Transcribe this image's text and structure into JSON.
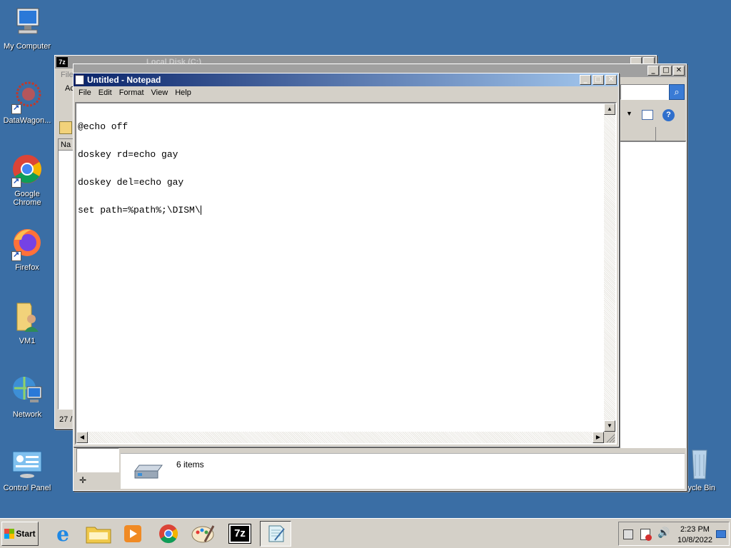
{
  "desktop": {
    "icons": [
      {
        "label": "My Computer",
        "icon": "my-computer-icon"
      },
      {
        "label": "DataWagon...",
        "icon": "datawagon-icon"
      },
      {
        "label": "Google Chrome",
        "icon": "chrome-icon"
      },
      {
        "label": "Firefox",
        "icon": "firefox-icon"
      },
      {
        "label": "VM1",
        "icon": "user-folder-icon"
      },
      {
        "label": "Network",
        "icon": "network-icon"
      },
      {
        "label": "Control Panel",
        "icon": "control-panel-icon"
      },
      {
        "label": "cycle Bin",
        "icon": "recycle-bin-icon"
      }
    ]
  },
  "explorer_back": {
    "title_fragment": "Local Disk (C:)",
    "menu_file": "File",
    "address_fragment": "Ac",
    "column_name": "Na",
    "status_count": "27 /"
  },
  "explorer_front": {
    "details_text": "6 items"
  },
  "notepad": {
    "title": "Untitled - Notepad",
    "menu": [
      "File",
      "Edit",
      "Format",
      "View",
      "Help"
    ],
    "lines": [
      "@echo off",
      "doskey rd=echo gay",
      "doskey del=echo gay",
      "set path=%path%;\\DISM\\"
    ],
    "buttons": {
      "minimize": "_",
      "maximize": "□",
      "close": "✕"
    }
  },
  "taskbar": {
    "start_label": "Start",
    "apps": [
      {
        "name": "internet-explorer",
        "icon": "ie-icon"
      },
      {
        "name": "file-explorer",
        "icon": "folder-icon"
      },
      {
        "name": "media-player",
        "icon": "media-player-icon"
      },
      {
        "name": "chrome",
        "icon": "chrome-icon"
      },
      {
        "name": "paint",
        "icon": "paint-icon"
      },
      {
        "name": "7zip",
        "icon": "7zip-icon"
      },
      {
        "name": "notepad",
        "icon": "notepad-icon"
      }
    ],
    "clock_time": "2:23 PM",
    "clock_date": "10/8/2022"
  },
  "colors": {
    "desktop": "#3a6ea5",
    "title_active_start": "#0a246a",
    "title_active_end": "#a6caf0",
    "title_inactive": "#808080",
    "chrome": "#d4d0c8"
  }
}
